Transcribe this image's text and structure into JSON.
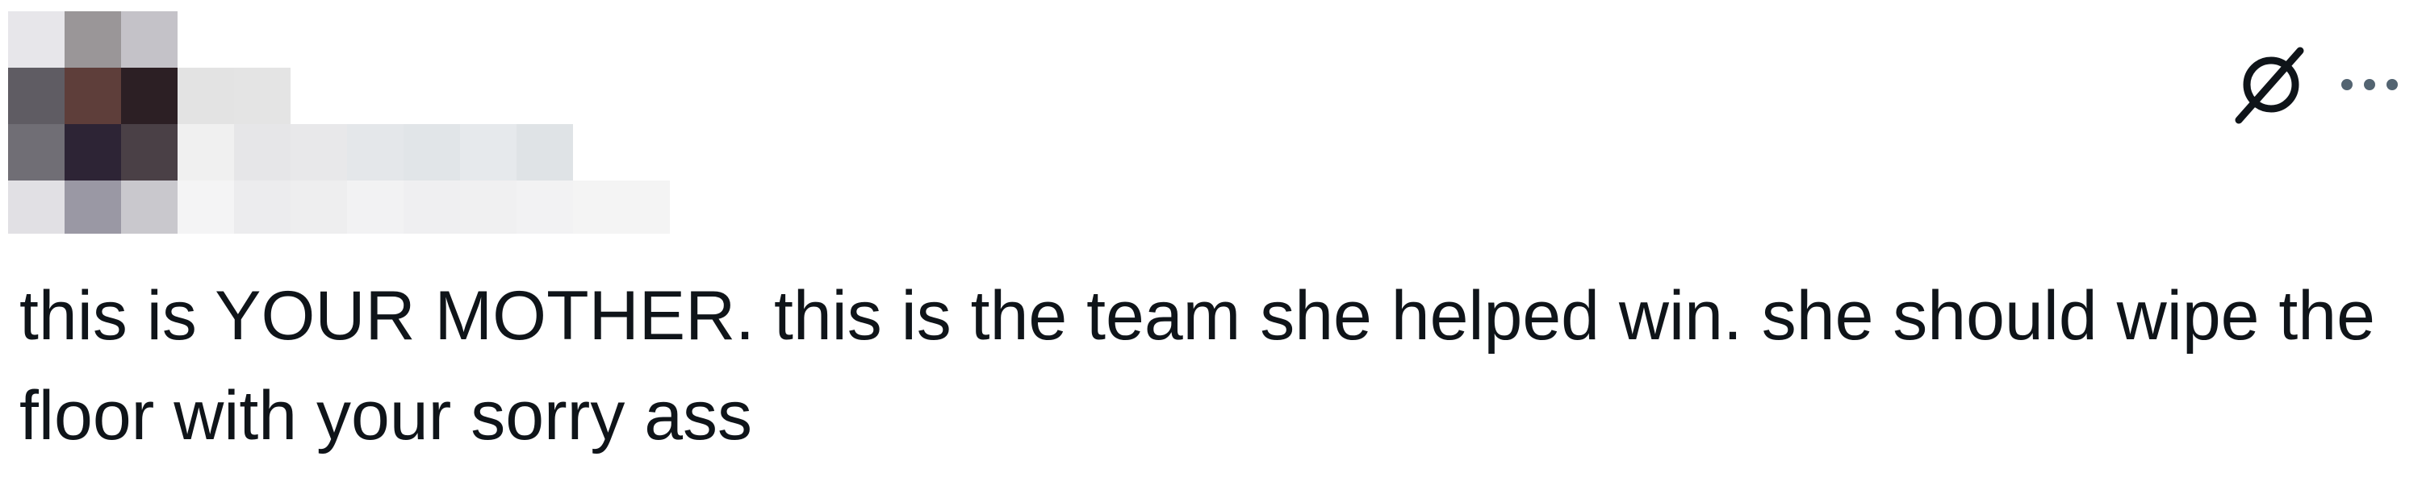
{
  "post": {
    "author": {
      "avatar": "pixelated-avatar",
      "display_name": "",
      "handle": ""
    },
    "text": "this is YOUR MOTHER. this is the team she helped win. she should wipe the floor with your sorry ass",
    "actions": {
      "grok_icon": "grok-icon",
      "more_icon": "more-horizontal-icon"
    }
  },
  "colors": {
    "text": "#0f1419",
    "icon": "#0f1419",
    "more_icon": "#536471",
    "background": "#ffffff"
  }
}
